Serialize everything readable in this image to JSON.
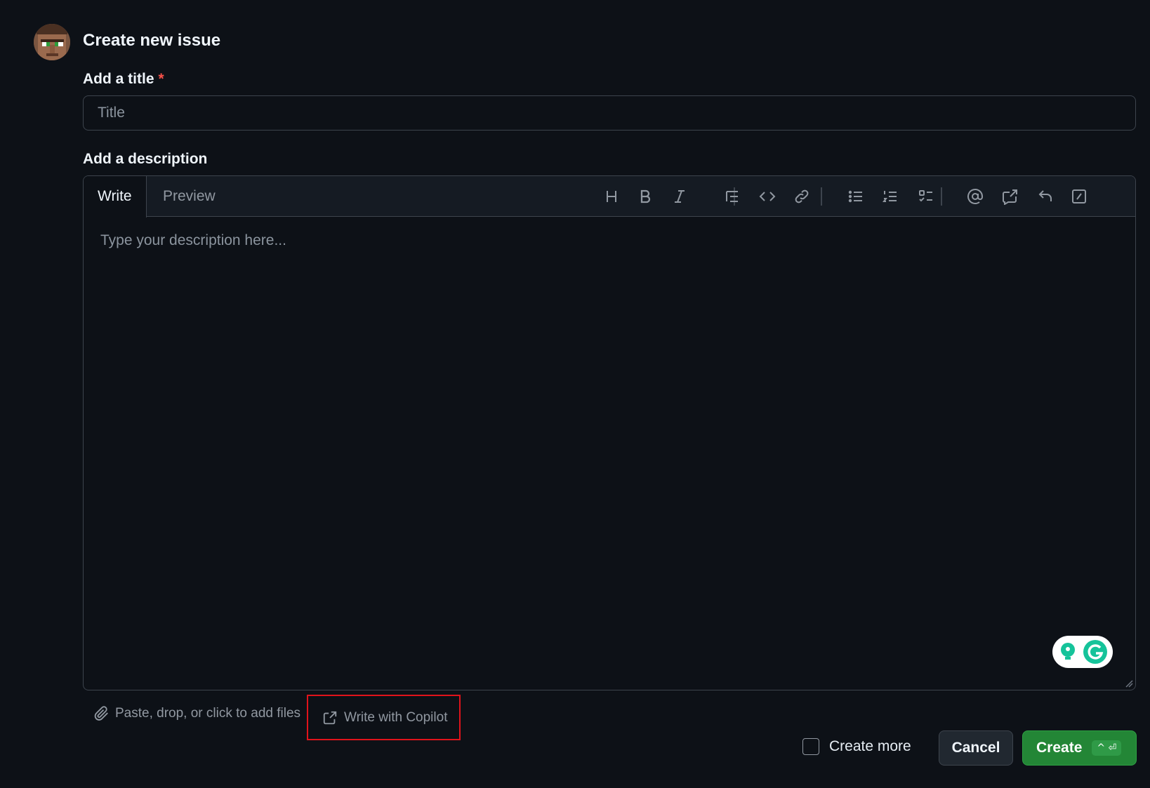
{
  "header": {
    "title": "Create new issue",
    "avatar_icon": "villager-avatar"
  },
  "title_field": {
    "label": "Add a title",
    "required_mark": "*",
    "placeholder": "Title",
    "value": ""
  },
  "description": {
    "label": "Add a description",
    "tabs": [
      {
        "label": "Write",
        "active": true
      },
      {
        "label": "Preview",
        "active": false
      }
    ],
    "toolbar": [
      "heading-icon",
      "bold-icon",
      "italic-icon",
      "quote-icon",
      "code-icon",
      "link-icon",
      "unordered-list-icon",
      "ordered-list-icon",
      "task-list-icon",
      "mention-icon",
      "reference-icon",
      "undo-icon",
      "slash-command-icon"
    ],
    "placeholder": "Type your description here...",
    "value": ""
  },
  "footer": {
    "attach_label": "Paste, drop, or click to add files",
    "copilot_label": "Write with Copilot",
    "create_more_label": "Create more",
    "create_more_checked": false,
    "cancel_label": "Cancel",
    "create_label": "Create",
    "create_shortcut": "^ ⏎"
  },
  "colors": {
    "background": "#0d1117",
    "create_button": "#238636",
    "highlight_box": "#e0131b",
    "required": "#f85149"
  }
}
